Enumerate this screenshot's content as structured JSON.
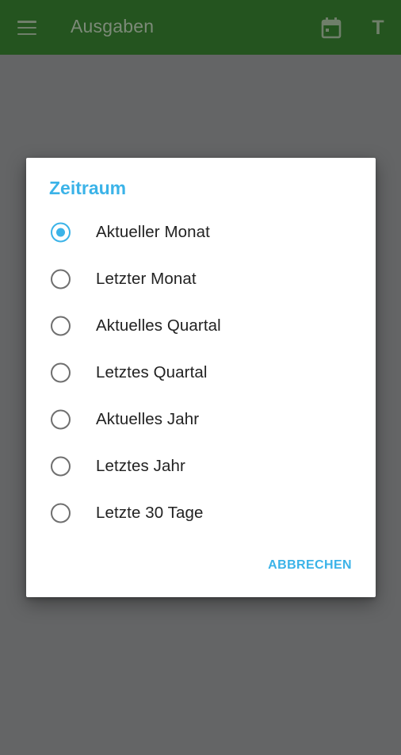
{
  "appbar": {
    "title": "Ausgaben",
    "menu_icon": "hamburger-menu-icon",
    "calendar_icon": "calendar-icon",
    "text_icon_label": "T",
    "color": "#24541f"
  },
  "dialog": {
    "title": "Zeitraum",
    "accent_color": "#3bb3e8",
    "selected_index": 0,
    "options": [
      {
        "label": "Aktueller Monat",
        "checked": true
      },
      {
        "label": "Letzter Monat",
        "checked": false
      },
      {
        "label": "Aktuelles Quartal",
        "checked": false
      },
      {
        "label": "Letztes Quartal",
        "checked": false
      },
      {
        "label": "Aktuelles Jahr",
        "checked": false
      },
      {
        "label": "Letztes Jahr",
        "checked": false
      },
      {
        "label": "Letzte 30 Tage",
        "checked": false
      }
    ],
    "cancel_label": "ABBRECHEN"
  }
}
